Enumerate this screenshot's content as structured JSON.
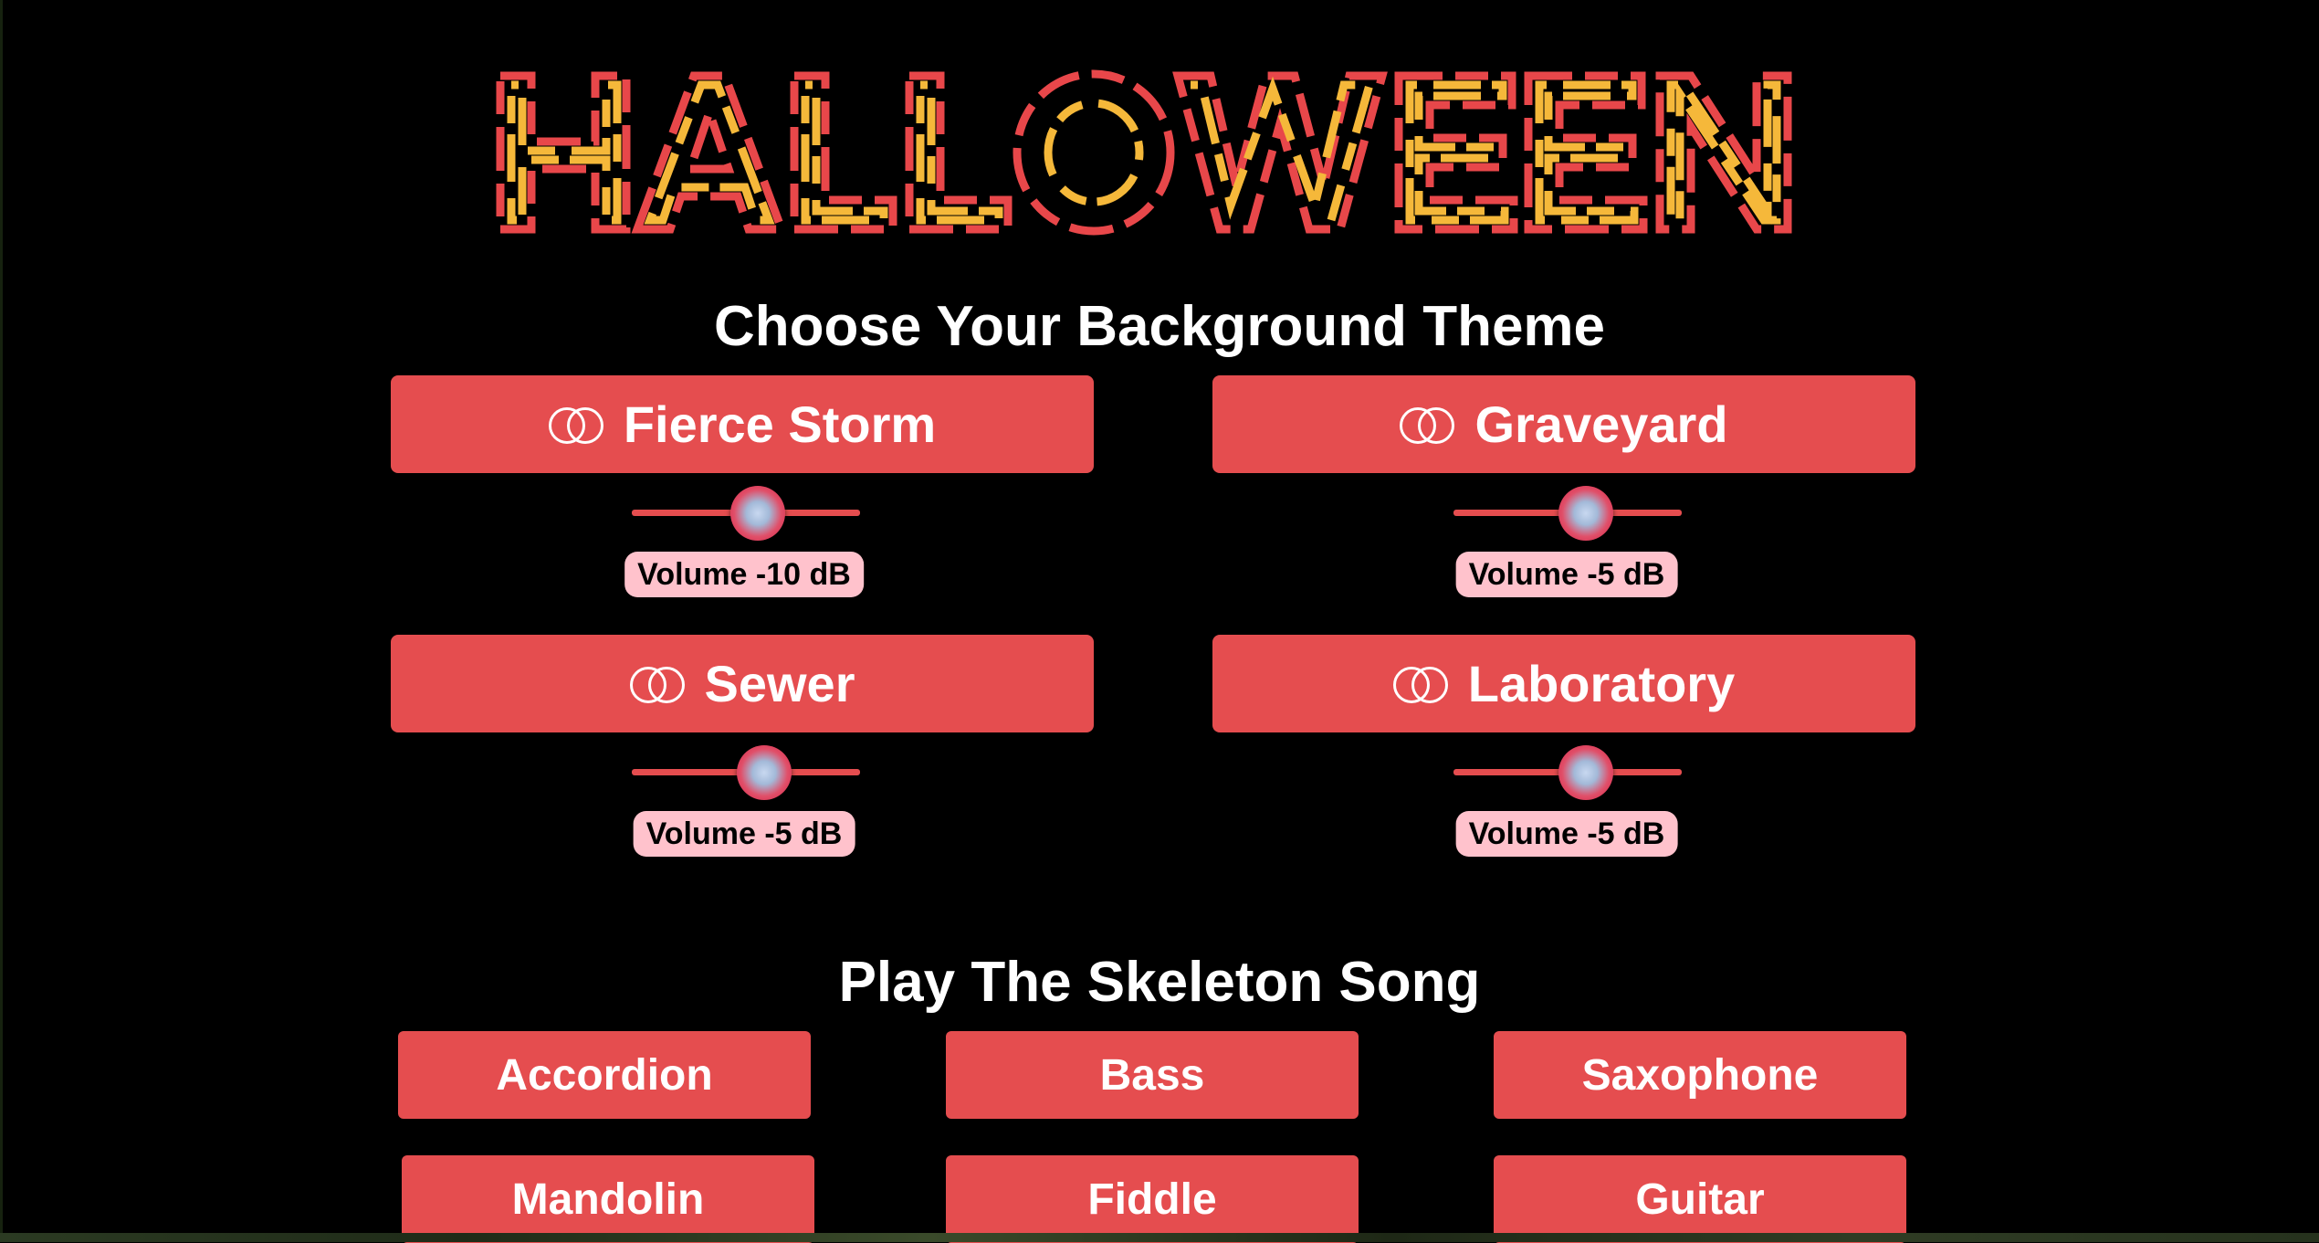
{
  "title": "HALLOWEEN",
  "colors": {
    "accent": "#e54d4f",
    "title_red": "#e8474a",
    "title_yellow": "#f5b83a",
    "volume_badge": "#ffc2cc",
    "background": "#000000"
  },
  "themes_section": {
    "heading": "Choose Your Background Theme",
    "themes": [
      {
        "label": "Fierce Storm",
        "icon": "toggle-icon",
        "volume_label": "Volume -10 dB",
        "volume_db": -10,
        "level": 0.55
      },
      {
        "label": "Graveyard",
        "icon": "toggle-icon",
        "volume_label": "Volume -5 dB",
        "volume_db": -5,
        "level": 0.58
      },
      {
        "label": "Sewer",
        "icon": "toggle-icon",
        "volume_label": "Volume -5 dB",
        "volume_db": -5,
        "level": 0.58
      },
      {
        "label": "Laboratory",
        "icon": "toggle-icon",
        "volume_label": "Volume -5 dB",
        "volume_db": -5,
        "level": 0.58
      }
    ]
  },
  "song_section": {
    "heading": "Play The Skeleton Song",
    "instruments": [
      "Accordion",
      "Bass",
      "Saxophone",
      "Mandolin",
      "Fiddle",
      "Guitar"
    ]
  }
}
